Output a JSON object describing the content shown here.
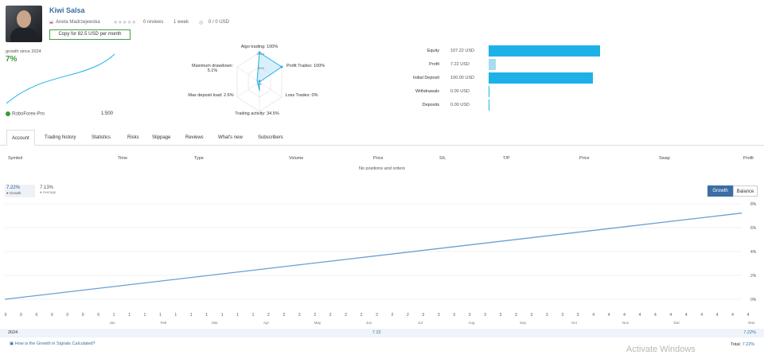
{
  "header": {
    "title": "Kiwi Salsa",
    "author": "Aneta Madrzejewska",
    "reviews": "0 reviews",
    "weeks": "1 week",
    "subscribers_stats": "0 / 0 USD",
    "copy_button": "Copy for 82.5 USD per month"
  },
  "summary": {
    "growth_since": "growth since 2024",
    "growth_value": "7%",
    "broker": "RoboForex-Pro",
    "leverage": "1:500"
  },
  "radar": {
    "top": "Algo trading: 100%",
    "right": "Profit Trades: 100%",
    "left_top": "Maximum drawdown: 5.1%",
    "left_bottom": "Max deposit load: 2.6%",
    "right_bottom": "Loss Trades: 0%",
    "bottom": "Trading activity: 34.5%",
    "ring_labels": [
      "100%",
      "50%",
      "0%"
    ]
  },
  "bars": [
    {
      "label": "Equity",
      "value": "107.22 USD",
      "amount": 107.22,
      "color": "#1eb1e8"
    },
    {
      "label": "Profit",
      "value": "7.22 USD",
      "amount": 7.22,
      "color": "#a8dcf2"
    },
    {
      "label": "Initial Deposit",
      "value": "100.00 USD",
      "amount": 100.0,
      "color": "#1eb1e8"
    },
    {
      "label": "Withdrawals",
      "value": "0.00 USD",
      "amount": 0,
      "color": "#1eb1e8"
    },
    {
      "label": "Deposits",
      "value": "0.00 USD",
      "amount": 0,
      "color": "#1eb1e8"
    }
  ],
  "tabs": [
    "Account",
    "Trading history",
    "Statistics",
    "Risks",
    "Slippage",
    "Reviews",
    "What's new",
    "Subscribers"
  ],
  "table": {
    "headers": [
      "Symbol",
      "Time",
      "Type",
      "Volume",
      "Price",
      "S/L",
      "T/P",
      "Price",
      "Swap",
      "Profit"
    ],
    "empty": "No positions and orders"
  },
  "chart_legend": {
    "growth_value": "7.22%",
    "growth_label": "Growth",
    "avg_value": "7.13%",
    "avg_label": "Average"
  },
  "chart_buttons": {
    "growth": "Growth",
    "balance": "Balance"
  },
  "chart_data": {
    "type": "line",
    "title": "",
    "ytick_labels": [
      "8%",
      "6%",
      "4%",
      "2%",
      "0%"
    ],
    "ylim": [
      0,
      8
    ],
    "x": [
      0,
      1
    ],
    "series": [
      {
        "values": [
          0.0,
          7.22
        ],
        "color": "#6a9fd0"
      }
    ],
    "x_labels": [
      "0",
      "0",
      "0",
      "0",
      "0",
      "0",
      "0",
      "1",
      "1",
      "1",
      "1",
      "1",
      "1",
      "1",
      "1",
      "1",
      "1",
      "2",
      "2",
      "2",
      "2",
      "2",
      "2",
      "2",
      "2",
      "2",
      "2",
      "3",
      "3",
      "3",
      "3",
      "3",
      "3",
      "3",
      "3",
      "3",
      "3",
      "3",
      "4",
      "4",
      "4",
      "4",
      "4",
      "4",
      "4",
      "4",
      "4",
      "4",
      "4"
    ],
    "month_labels": [
      "Jan",
      "Feb",
      "Mar",
      "Apr",
      "May",
      "Jun",
      "Jul",
      "Aug",
      "Sep",
      "Oct",
      "Nov",
      "Dec"
    ],
    "grid": true
  },
  "footer": {
    "year": "2024",
    "year_value": "7.22",
    "end_label": "Year",
    "end_value": "7.22%",
    "calc_link": "How is the Growth in Signals Calculated?",
    "total_label": "Total:",
    "total_value": "7.22%"
  },
  "watermark": "Activate Windows"
}
